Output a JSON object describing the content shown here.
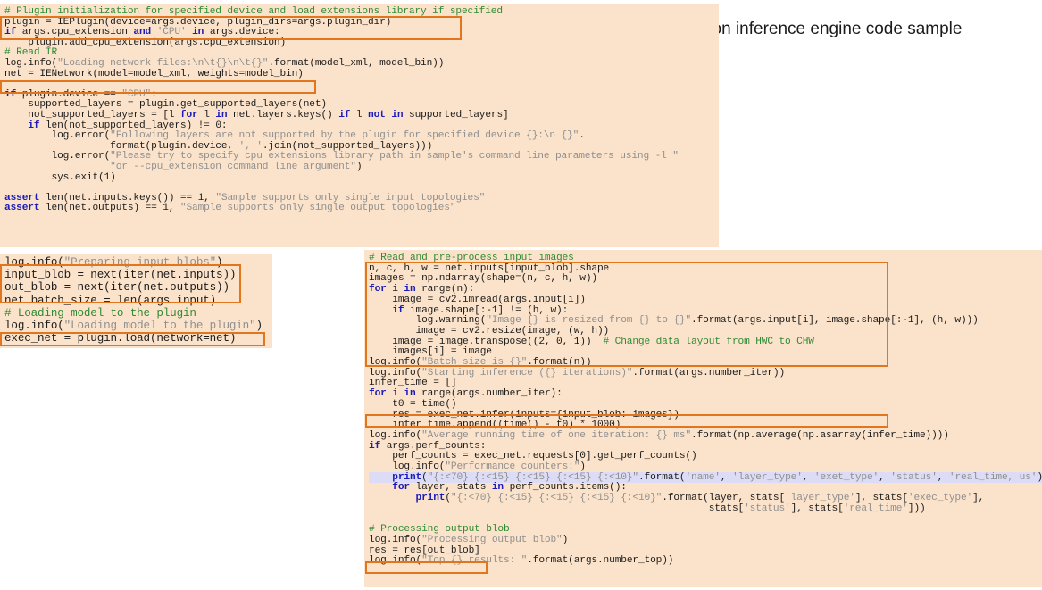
{
  "title": "Python version inference engine code sample",
  "colors": {
    "panel_background": "#fbe3cb",
    "highlight_box": "#e2761e",
    "comment": "#2f8a32",
    "keyword": "#1b1bbb",
    "string": "#8f8f8f",
    "selected_line": "#dcdcf6"
  },
  "panels": [
    {
      "name": "initialization",
      "lines": [
        "# Plugin initialization for specified device and load extensions library if specified",
        "plugin = IEPlugin(device=args.device, plugin_dirs=args.plugin_dir)",
        "if args.cpu_extension and 'CPU' in args.device:",
        "    plugin.add_cpu_extension(args.cpu_extension)",
        "# Read IR",
        "log.info(\"Loading network files:\\n\\t{}\\n\\t{}\".format(model_xml, model_bin))",
        "net = IENetwork(model=model_xml, weights=model_bin)",
        "",
        "if plugin.device == \"CPU\":",
        "    supported_layers = plugin.get_supported_layers(net)",
        "    not_supported_layers = [l for l in net.layers.keys() if l not in supported_layers]",
        "    if len(not_supported_layers) != 0:",
        "        log.error(\"Following layers are not supported by the plugin for specified device {}:\\n {}\".",
        "                  format(plugin.device, ', '.join(not_supported_layers)))",
        "        log.error(\"Please try to specify cpu extensions library path in sample's command line parameters using -l \"",
        "                  \"or --cpu_extension command line argument\")",
        "        sys.exit(1)",
        "",
        "assert len(net.inputs.keys()) == 1, \"Sample supports only single input topologies\"",
        "assert len(net.outputs) == 1, \"Sample supports only single output topologies\""
      ]
    },
    {
      "name": "load-model",
      "lines": [
        "log.info(\"Preparing input blobs\")",
        "input_blob = next(iter(net.inputs))",
        "out_blob = next(iter(net.outputs))",
        "net.batch_size = len(args.input)",
        "# Loading model to the plugin",
        "log.info(\"Loading model to the plugin\")",
        "exec_net = plugin.load(network=net)"
      ]
    },
    {
      "name": "inference",
      "lines": [
        "# Read and pre-process input images",
        "n, c, h, w = net.inputs[input_blob].shape",
        "images = np.ndarray(shape=(n, c, h, w))",
        "for i in range(n):",
        "    image = cv2.imread(args.input[i])",
        "    if image.shape[:-1] != (h, w):",
        "        log.warning(\"Image {} is resized from {} to {}\".format(args.input[i], image.shape[:-1], (h, w)))",
        "        image = cv2.resize(image, (w, h))",
        "    image = image.transpose((2, 0, 1))  # Change data layout from HWC to CHW",
        "    images[i] = image",
        "log.info(\"Batch size is {}\".format(n))",
        "log.info(\"Starting inference ({} iterations)\".format(args.number_iter))",
        "infer_time = []",
        "for i in range(args.number_iter):",
        "    t0 = time()",
        "    res = exec_net.infer(inputs={input_blob: images})",
        "    infer_time.append((time() - t0) * 1000)",
        "log.info(\"Average running time of one iteration: {} ms\".format(np.average(np.asarray(infer_time))))",
        "if args.perf_counts:",
        "    perf_counts = exec_net.requests[0].get_perf_counts()",
        "    log.info(\"Performance counters:\")",
        "    print(\"{:<70} {:<15} {:<15} {:<15} {:<10}\".format('name', 'layer_type', 'exet_type', 'status', 'real_time, us'))",
        "    for layer, stats in perf_counts.items():",
        "        print(\"{:<70} {:<15} {:<15} {:<15} {:<10}\".format(layer, stats['layer_type'], stats['exec_type'],",
        "                                                          stats['status'], stats['real_time']))",
        "",
        "# Processing output blob",
        "log.info(\"Processing output blob\")",
        "res = res[out_blob]",
        "log.info(\"Top {} results: \".format(args.number_top))"
      ]
    }
  ]
}
